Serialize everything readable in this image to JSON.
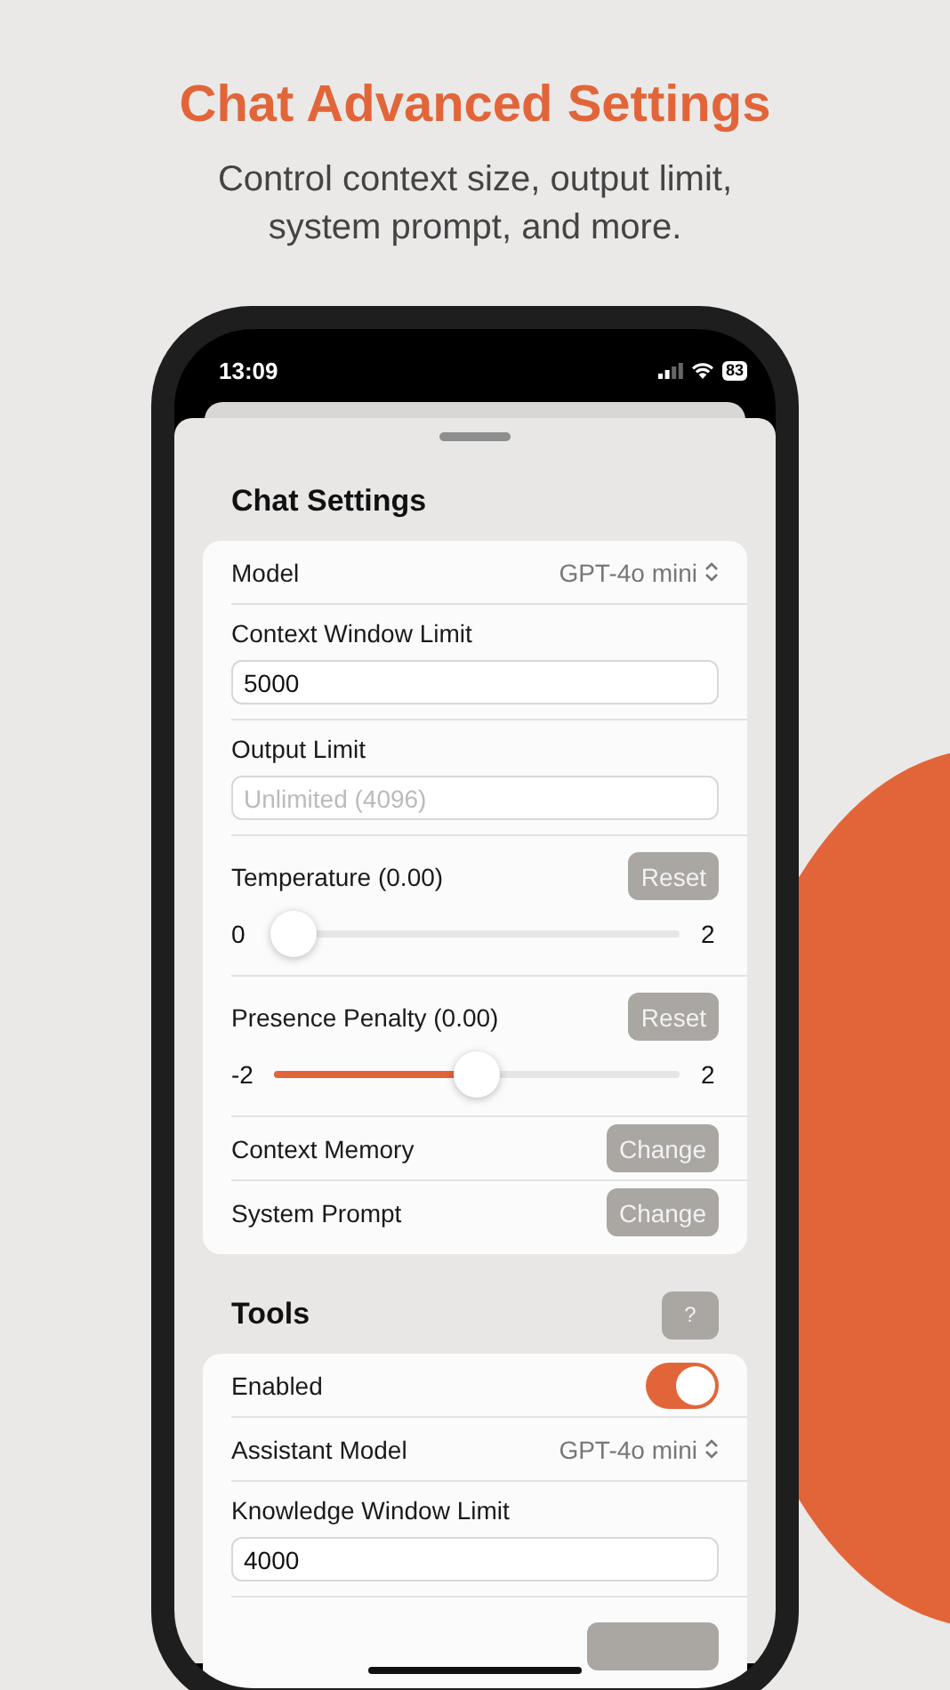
{
  "heading": "Chat Advanced Settings",
  "subheading": "Control context size, output limit, system prompt, and more.",
  "status_bar": {
    "time": "13:09",
    "battery": "83"
  },
  "sections": [
    {
      "title": "Chat Settings",
      "rows": [
        {
          "kind": "picker",
          "label": "Model",
          "value": "GPT-4o mini"
        },
        {
          "kind": "input",
          "label": "Context Window Limit",
          "value": "5000"
        },
        {
          "kind": "input",
          "label": "Output Limit",
          "placeholder": "Unlimited (4096)"
        },
        {
          "kind": "slider",
          "label": "Temperature (0.00)",
          "button": "Reset",
          "min": "0",
          "max": "2",
          "level": 0
        },
        {
          "kind": "slider",
          "label": "Presence Penalty (0.00)",
          "button": "Reset",
          "min": "-2",
          "max": "2",
          "level": 0.5
        },
        {
          "kind": "action",
          "label": "Context Memory",
          "button": "Change"
        },
        {
          "kind": "action",
          "label": "System Prompt",
          "button": "Change"
        }
      ]
    },
    {
      "title": "Tools",
      "help_button": "?",
      "rows": [
        {
          "kind": "toggle",
          "label": "Enabled",
          "on": true
        },
        {
          "kind": "picker",
          "label": "Assistant Model",
          "value": "GPT-4o mini"
        },
        {
          "kind": "input",
          "label": "Knowledge Window Limit",
          "value": "4000"
        }
      ]
    }
  ]
}
